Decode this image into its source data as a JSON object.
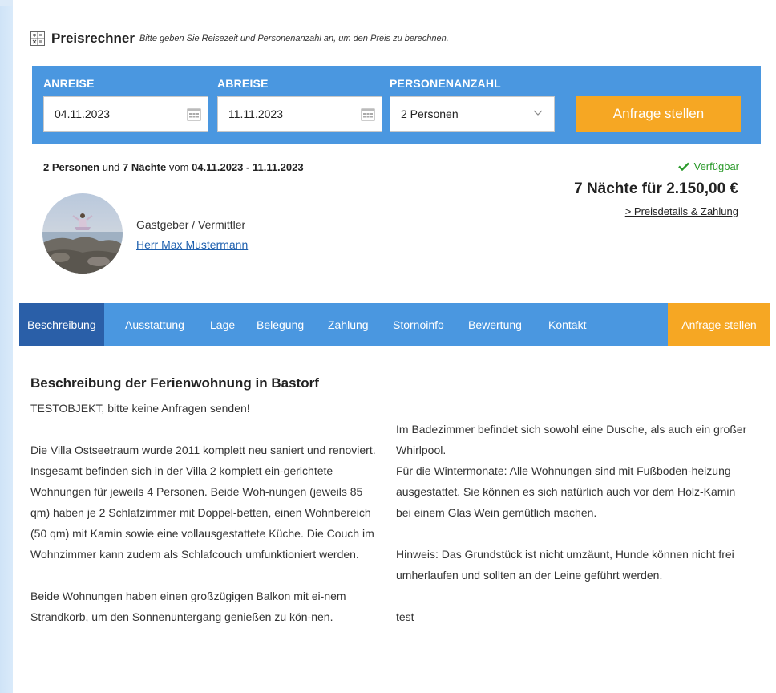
{
  "calculator": {
    "title": "Preisrechner",
    "hint": "Bitte geben Sie Reisezeit und Personenanzahl an, um den Preis zu berechnen."
  },
  "form": {
    "arrival_label": "ANREISE",
    "arrival_value": "04.11.2023",
    "departure_label": "ABREISE",
    "departure_value": "11.11.2023",
    "persons_label": "PERSONENANZAHL",
    "persons_value": "2 Personen",
    "submit_label": "Anfrage stellen"
  },
  "summary": {
    "persons": "2 Personen",
    "and": "und",
    "nights": "7 Nächte",
    "from": "vom",
    "range": "04.11.2023 - 11.11.2023",
    "availability": "Verfügbar",
    "price": "7 Nächte für 2.150,00 €",
    "price_link": "> Preisdetails & Zahlung"
  },
  "host": {
    "role": "Gastgeber / Vermittler",
    "name": "Herr Max Mustermann"
  },
  "tabs": {
    "items": [
      "Beschreibung",
      "Ausstattung",
      "Lage",
      "Belegung",
      "Zahlung",
      "Stornoinfo",
      "Bewertung",
      "Kontakt"
    ],
    "cta": "Anfrage stellen"
  },
  "description": {
    "title": "Beschreibung der Ferienwohnung in Bastorf",
    "col1": [
      "TESTOBJEKT, bitte keine Anfragen senden!",
      "Die Villa Ostseetraum wurde 2011 komplett neu saniert und renoviert. Insgesamt befinden sich in der Villa 2 komplett ein-gerichtete Wohnungen für jeweils 4 Personen. Beide Woh-nungen (jeweils 85 qm) haben je 2 Schlafzimmer mit Doppel-betten, einen Wohnbereich (50 qm) mit Kamin sowie eine vollausgestattete Küche. Die Couch im Wohnzimmer kann zudem als Schlafcouch umfunktioniert werden.",
      "Beide Wohnungen haben einen großzügigen Balkon mit ei-nem Strandkorb, um den Sonnenuntergang genießen zu kön-nen."
    ],
    "col2": [
      "Im Badezimmer befindet sich sowohl eine Dusche, als auch ein großer Whirlpool.",
      "Für die Wintermonate: Alle Wohnungen sind mit Fußboden-heizung ausgestattet. Sie können es sich natürlich auch vor dem Holz-Kamin bei einem Glas Wein gemütlich machen.",
      "Hinweis: Das Grundstück ist nicht umzäunt, Hunde können nicht frei umherlaufen und sollten an der Leine geführt werden.",
      "test"
    ]
  }
}
